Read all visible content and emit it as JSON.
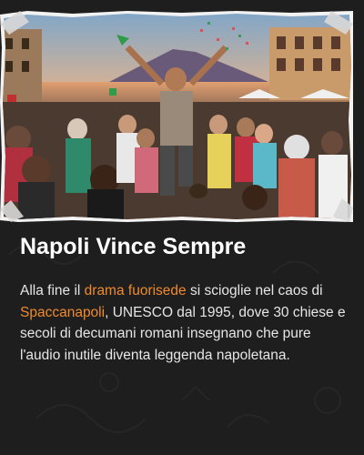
{
  "card": {
    "image_alt": "Celebrating crowd in a Naples square at sunset with Vesuvius in the background",
    "title": "Napoli Vince Sempre",
    "body": {
      "part1": "Alla fine il ",
      "highlight1": "drama fuorisede",
      "part2": " si scioglie nel caos di ",
      "highlight2": "Spaccanapoli",
      "part3": ", UNESCO dal 1995, dove 30 chiese e secoli di decumani romani insegnano che pure l'audio inutile diventa leggenda napoletana."
    }
  },
  "colors": {
    "background": "#1e1e1e",
    "title": "#ffffff",
    "text": "#e6e6e6",
    "highlight": "#f08a2c"
  }
}
